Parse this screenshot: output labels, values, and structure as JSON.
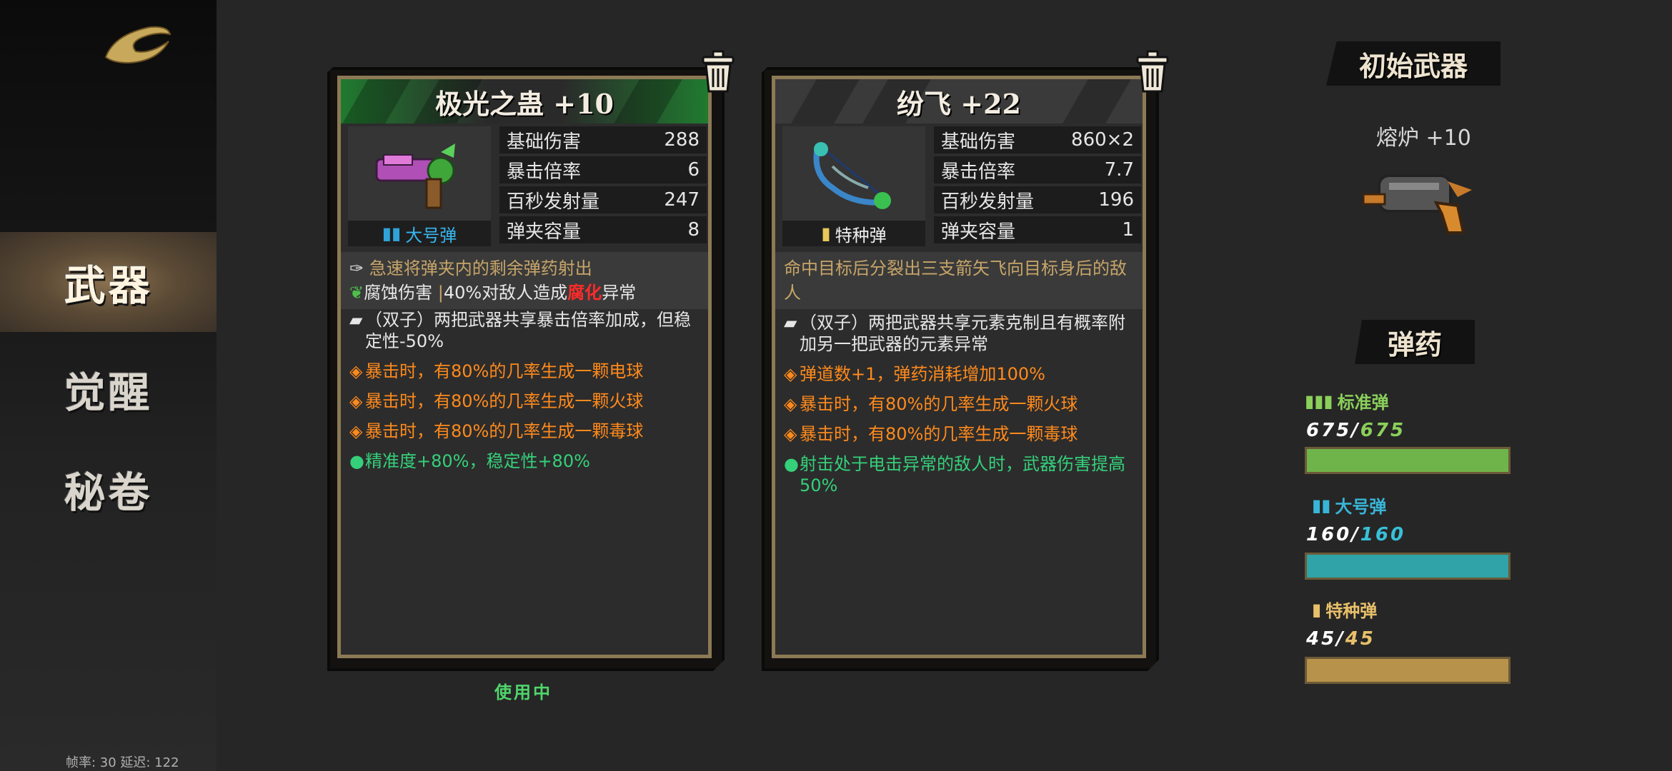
{
  "sidebar": {
    "logo": "game-logo",
    "items": [
      {
        "label": "武器",
        "active": true
      },
      {
        "label": "觉醒",
        "active": false
      },
      {
        "label": "秘卷",
        "active": false
      }
    ],
    "fps_text": "帧率: 30   延迟: 122"
  },
  "cards": [
    {
      "title": "极光之蛊 +10",
      "ammo_type": "大号弹",
      "stats": [
        {
          "label": "基础伤害",
          "value": "288"
        },
        {
          "label": "暴击倍率",
          "value": "6"
        },
        {
          "label": "百秒发射量",
          "value": "247"
        },
        {
          "label": "弹夹容量",
          "value": "8"
        }
      ],
      "desc_line1": "急速将弹夹内的剩余弹药射出",
      "desc_line2_a": "腐蚀伤害",
      "desc_line2_b": "40%对敌人造成",
      "desc_line2_c": "腐化",
      "desc_line2_d": "异常",
      "perks": [
        {
          "type": "white",
          "bullet": "▰",
          "text": "（双子）两把武器共享暴击倍率加成，但稳定性-50%"
        },
        {
          "type": "orange",
          "bullet": "◈",
          "text": "暴击时，有80%的几率生成一颗电球"
        },
        {
          "type": "orange",
          "bullet": "◈",
          "text": "暴击时，有80%的几率生成一颗火球"
        },
        {
          "type": "orange",
          "bullet": "◈",
          "text": "暴击时，有80%的几率生成一颗毒球"
        },
        {
          "type": "green",
          "bullet": "●",
          "text": "精准度+80%，稳定性+80%"
        }
      ],
      "status": "使用中"
    },
    {
      "title": "纷飞 +22",
      "ammo_type": "特种弹",
      "stats": [
        {
          "label": "基础伤害",
          "value": "860×2"
        },
        {
          "label": "暴击倍率",
          "value": "7.7"
        },
        {
          "label": "百秒发射量",
          "value": "196"
        },
        {
          "label": "弹夹容量",
          "value": "1"
        }
      ],
      "desc_line1": "命中目标后分裂出三支箭矢飞向目标身后的敌人",
      "perks": [
        {
          "type": "white",
          "bullet": "▰",
          "text": "（双子）两把武器共享元素克制且有概率附加另一把武器的元素异常"
        },
        {
          "type": "orange",
          "bullet": "◈",
          "text": "弹道数+1，弹药消耗增加100%"
        },
        {
          "type": "orange",
          "bullet": "◈",
          "text": "暴击时，有80%的几率生成一颗火球"
        },
        {
          "type": "orange",
          "bullet": "◈",
          "text": "暴击时，有80%的几率生成一颗毒球"
        },
        {
          "type": "green",
          "bullet": "●",
          "text": "射击处于电击异常的敌人时，武器伤害提高50%"
        }
      ]
    }
  ],
  "right_panel": {
    "start_weapon_title": "初始武器",
    "start_weapon_name": "熔炉  +10",
    "ammo_title": "弹药",
    "ammo": [
      {
        "name": "标准弹",
        "current": "675",
        "max": "675",
        "color": "#6fb44a",
        "fill": 1.0
      },
      {
        "name": "大号弹",
        "current": "160",
        "max": "160",
        "color": "#2fa3a8",
        "fill": 1.0
      },
      {
        "name": "特种弹",
        "current": "45",
        "max": "45",
        "color": "#b6924a",
        "fill": 1.0
      }
    ]
  },
  "colors": {
    "frame": "#8c7a55",
    "orange": "#ff8a1c",
    "green": "#35d07a",
    "gold": "#c7a569"
  }
}
